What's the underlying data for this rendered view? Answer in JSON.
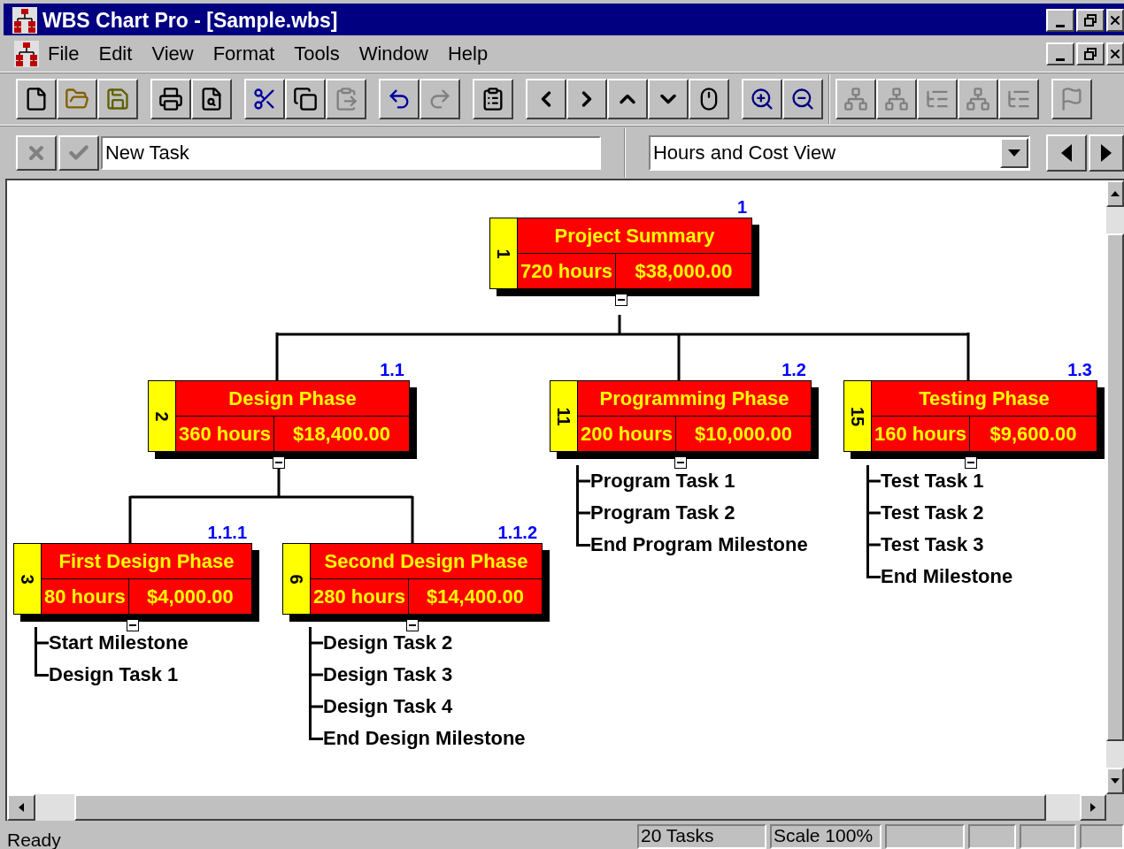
{
  "window": {
    "title": "WBS Chart Pro - [Sample.wbs]"
  },
  "menu": [
    "File",
    "Edit",
    "View",
    "Format",
    "Tools",
    "Window",
    "Help"
  ],
  "toolbar": [
    {
      "kind": "new",
      "disabled": false
    },
    {
      "kind": "open",
      "disabled": false
    },
    {
      "kind": "save",
      "disabled": false
    },
    {
      "kind": "sep"
    },
    {
      "kind": "print",
      "disabled": false
    },
    {
      "kind": "preview",
      "disabled": false
    },
    {
      "kind": "sep"
    },
    {
      "kind": "cut",
      "disabled": false
    },
    {
      "kind": "copy",
      "disabled": false
    },
    {
      "kind": "paste",
      "disabled": true
    },
    {
      "kind": "sep"
    },
    {
      "kind": "undo",
      "disabled": false
    },
    {
      "kind": "redo",
      "disabled": true
    },
    {
      "kind": "sep"
    },
    {
      "kind": "properties",
      "disabled": false
    },
    {
      "kind": "sep"
    },
    {
      "kind": "left",
      "disabled": false
    },
    {
      "kind": "right",
      "disabled": false
    },
    {
      "kind": "up",
      "disabled": false
    },
    {
      "kind": "down",
      "disabled": false
    },
    {
      "kind": "mouse",
      "disabled": false
    },
    {
      "kind": "sep"
    },
    {
      "kind": "zoom-in",
      "disabled": false
    },
    {
      "kind": "zoom-out",
      "disabled": false
    },
    {
      "kind": "bar"
    },
    {
      "kind": "org",
      "disabled": true
    },
    {
      "kind": "org",
      "disabled": true
    },
    {
      "kind": "tree",
      "disabled": true
    },
    {
      "kind": "org",
      "disabled": true
    },
    {
      "kind": "tree",
      "disabled": true
    },
    {
      "kind": "sep"
    },
    {
      "kind": "flag",
      "disabled": true
    }
  ],
  "edit_bar": {
    "cancel_disabled": true,
    "accept_disabled": true,
    "value": "New Task",
    "view": "Hours and Cost View"
  },
  "nodes": [
    {
      "id": "1",
      "title": "Project Summary",
      "hours": "720 hours",
      "cost": "$38,000.00",
      "wbs": "1",
      "expanded": true
    },
    {
      "id": "2",
      "title": "Design Phase",
      "hours": "360 hours",
      "cost": "$18,400.00",
      "wbs": "1.1",
      "expanded": true
    },
    {
      "id": "11",
      "title": "Programming Phase",
      "hours": "200 hours",
      "cost": "$10,000.00",
      "wbs": "1.2",
      "expanded": true,
      "tasks": [
        "Program Task 1",
        "Program Task 2",
        "End Program Milestone"
      ]
    },
    {
      "id": "15",
      "title": "Testing Phase",
      "hours": "160 hours",
      "cost": "$9,600.00",
      "wbs": "1.3",
      "expanded": true,
      "tasks": [
        "Test Task 1",
        "Test Task 2",
        "Test Task 3",
        "End Milestone"
      ]
    },
    {
      "id": "3",
      "title": "First Design Phase",
      "hours": "80 hours",
      "cost": "$4,000.00",
      "wbs": "1.1.1",
      "expanded": true,
      "tasks": [
        "Start Milestone",
        "Design Task 1"
      ]
    },
    {
      "id": "6",
      "title": "Second Design Phase",
      "hours": "280 hours",
      "cost": "$14,400.00",
      "wbs": "1.1.2",
      "expanded": true,
      "tasks": [
        "Design Task 2",
        "Design Task 3",
        "Design Task 4",
        "End Design Milestone"
      ]
    }
  ],
  "status_bar": {
    "message": "Ready",
    "tasks": "20 Tasks",
    "scale": "Scale 100%"
  }
}
